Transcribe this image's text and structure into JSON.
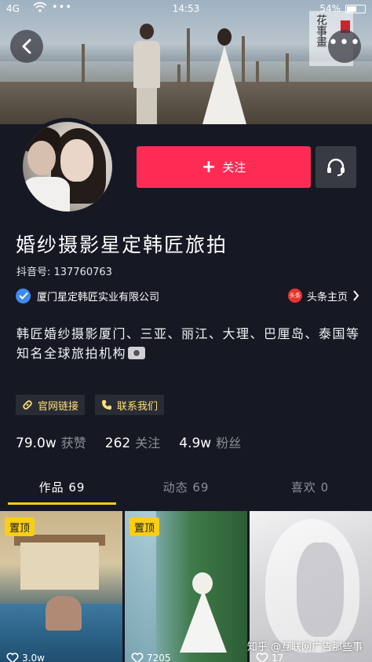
{
  "status_bar": {
    "signal": "4G",
    "more_indicator": "•••",
    "time": "14:53",
    "battery": "54%"
  },
  "cover": {
    "seal_text": "花事畫"
  },
  "profile": {
    "follow_label": "关注",
    "name": "婚纱摄影星定韩匠旅拍",
    "douyin_id": "抖音号: 137760763",
    "verified_company": "厦门星定韩匠实业有限公司",
    "toutiao_badge": "头条",
    "toutiao_label": "头条主页",
    "bio": "韩匠婚纱摄影厦门、三亚、丽江、大理、巴厘岛、泰国等知名全球旅拍机构",
    "links": {
      "website": "官网链接",
      "contact": "联系我们"
    }
  },
  "stats": [
    {
      "value": "79.0w",
      "label": "获赞"
    },
    {
      "value": "262",
      "label": "关注"
    },
    {
      "value": "4.9w",
      "label": "粉丝"
    }
  ],
  "tabs": [
    {
      "label": "作品 69",
      "active": true
    },
    {
      "label": "动态 69",
      "active": false
    },
    {
      "label": "喜欢 0",
      "active": false
    }
  ],
  "videos": [
    {
      "pinned_label": "置顶",
      "likes": "3.0w"
    },
    {
      "pinned_label": "置顶",
      "likes": "7205"
    },
    {
      "pinned_label": "",
      "likes": "17"
    }
  ],
  "watermark": "知乎 @互联网广告那些事",
  "colors": {
    "background": "#161823",
    "follow": "#fe2c55",
    "accent": "#face15",
    "verified": "#3b8cf0"
  }
}
